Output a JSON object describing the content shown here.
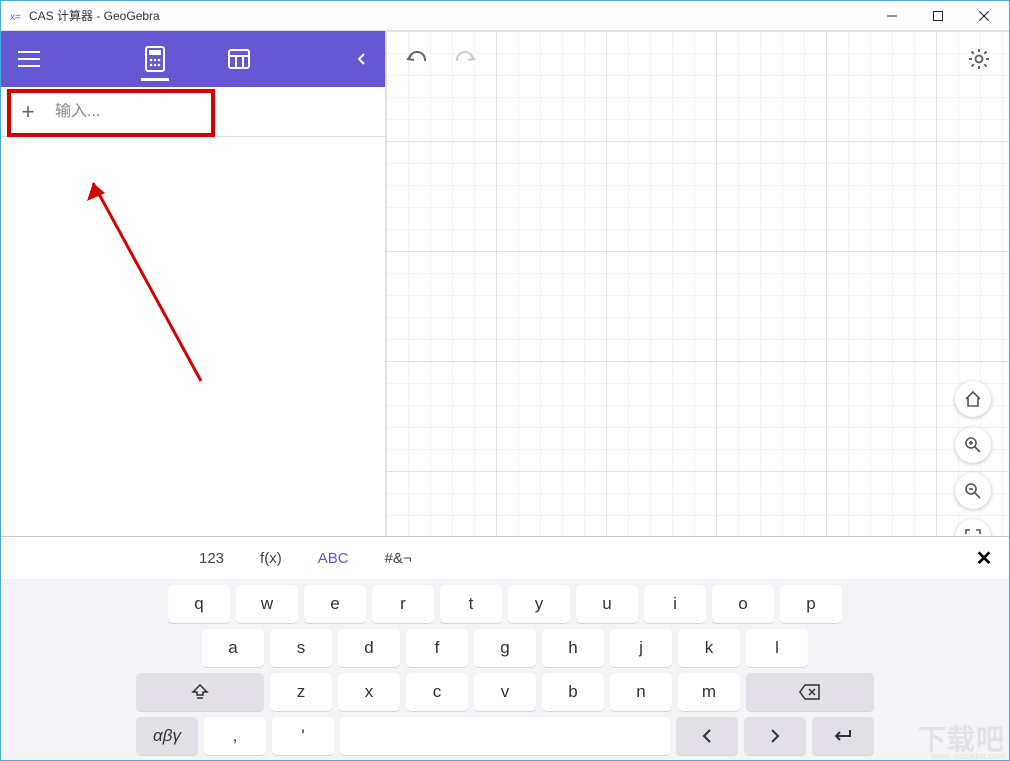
{
  "window": {
    "title": "CAS 计算器 - GeoGebra"
  },
  "input": {
    "placeholder": "输入..."
  },
  "keyboard": {
    "tabs": {
      "num": "123",
      "fx": "f(x)",
      "abc": "ABC",
      "sym": "#&¬"
    },
    "rows": {
      "r1": [
        "q",
        "w",
        "e",
        "r",
        "t",
        "y",
        "u",
        "i",
        "o",
        "p"
      ],
      "r2": [
        "a",
        "s",
        "d",
        "f",
        "g",
        "h",
        "j",
        "k",
        "l"
      ],
      "r3": [
        "z",
        "x",
        "c",
        "v",
        "b",
        "n",
        "m"
      ]
    },
    "greek_label": "αβγ",
    "comma": ","
  },
  "icons": {
    "calc": "calculator-icon",
    "table": "table-icon",
    "menu": "menu-icon",
    "collapse": "chevron-left-icon",
    "undo": "undo-icon",
    "redo": "redo-icon",
    "gear": "gear-icon",
    "home": "home-icon",
    "zoom_in": "zoom-in-icon",
    "zoom_out": "zoom-out-icon",
    "fullscreen": "fullscreen-icon",
    "shift": "shift-icon",
    "backspace": "backspace-icon",
    "left": "left-icon",
    "right": "right-icon",
    "enter": "enter-icon"
  },
  "watermark": {
    "big": "下载吧",
    "small": "www.xiazaiba.com"
  }
}
